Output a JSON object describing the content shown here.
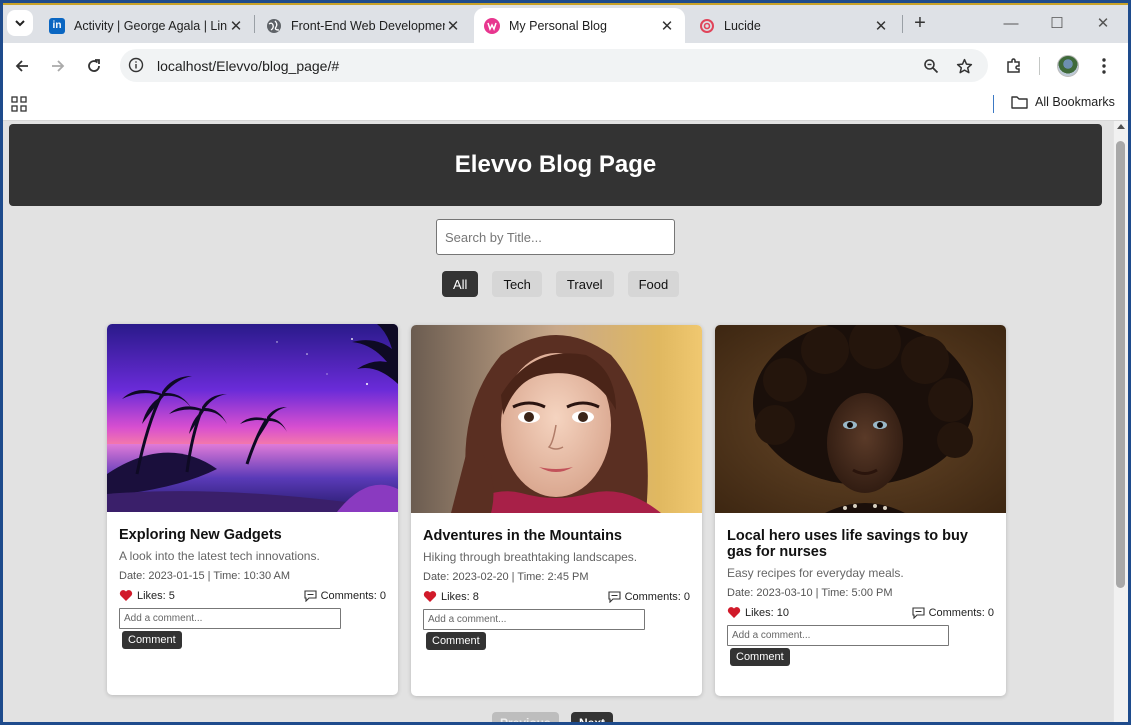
{
  "browser": {
    "tabs": [
      {
        "title": "Activity | George Agala | LinkedIn",
        "favicon": "linkedin-icon",
        "active": false
      },
      {
        "title": "Front-End Web Development",
        "favicon": "globe-icon",
        "active": false
      },
      {
        "title": "My Personal Blog",
        "favicon": "blog-icon",
        "active": true
      },
      {
        "title": "Lucide",
        "favicon": "lucide-icon",
        "active": false
      }
    ],
    "address": {
      "host": "localhost",
      "path": "/Elevvo/blog_page/#"
    },
    "bookmarks": {
      "all_label": "All Bookmarks"
    }
  },
  "page": {
    "title": "Elevvo Blog Page",
    "search": {
      "placeholder": "Search by Title..."
    },
    "filters": [
      "All",
      "Tech",
      "Travel",
      "Food"
    ],
    "active_filter": "All",
    "comment_placeholder": "Add a comment...",
    "comment_button": "Comment",
    "posts": [
      {
        "title": "Exploring New Gadgets",
        "description": "A look into the latest tech innovations.",
        "meta": "Date: 2023-01-15 | Time: 10:30 AM",
        "likes": "Likes: 5",
        "comments": "Comments: 0",
        "image": "tropical-sunset-beach"
      },
      {
        "title": "Adventures in the Mountains",
        "description": "Hiking through breathtaking landscapes.",
        "meta": "Date: 2023-02-20 | Time: 2:45 PM",
        "likes": "Likes: 8",
        "comments": "Comments: 0",
        "image": "portrait-young-woman"
      },
      {
        "title": "Local hero uses life savings to buy gas for nurses",
        "description": "Easy recipes for everyday meals.",
        "meta": "Date: 2023-03-10 | Time: 5:00 PM",
        "likes": "Likes: 10",
        "comments": "Comments: 0",
        "image": "portrait-child-afro"
      }
    ],
    "pagination": {
      "previous": "Previous",
      "next": "Next"
    }
  }
}
